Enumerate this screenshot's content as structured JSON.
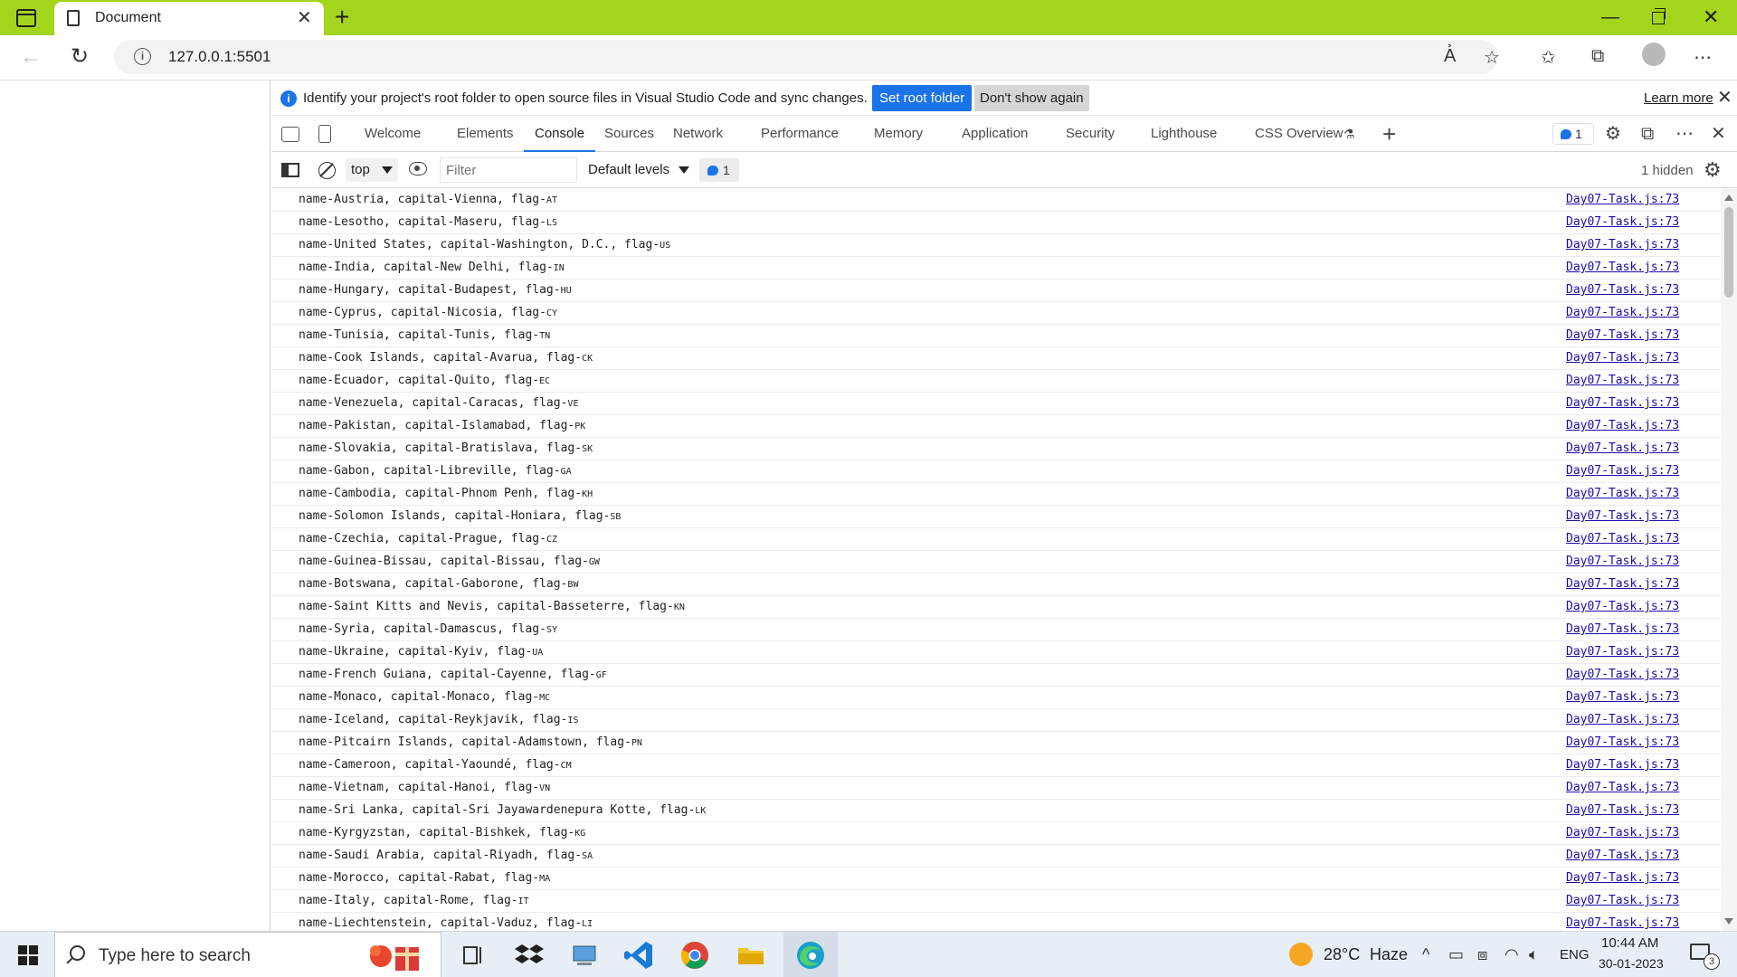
{
  "window": {
    "tab_title": "Document",
    "new_tab_glyph": "+",
    "close_glyph": "✕",
    "minimize_glyph": "—"
  },
  "address_bar": {
    "url": "127.0.0.1:5501",
    "icons": [
      "read-aloud-icon",
      "add-favorite-icon",
      "favorites-icon",
      "collections-icon",
      "profile-icon",
      "more-icon"
    ]
  },
  "infobar": {
    "message": "Identify your project's root folder to open source files in Visual Studio Code and sync changes.",
    "set_root_label": "Set root folder",
    "dont_show_label": "Don't show again",
    "learn_more_label": "Learn more"
  },
  "devtools": {
    "tabs": [
      {
        "label": "Welcome",
        "active": false
      },
      {
        "label": "Elements",
        "active": false
      },
      {
        "label": "Console",
        "active": true
      },
      {
        "label": "Sources",
        "active": false
      },
      {
        "label": "Network",
        "active": false
      },
      {
        "label": "Performance",
        "active": false
      },
      {
        "label": "Memory",
        "active": false
      },
      {
        "label": "Application",
        "active": false
      },
      {
        "label": "Security",
        "active": false
      },
      {
        "label": "Lighthouse",
        "active": false
      },
      {
        "label": "CSS Overview",
        "active": false
      }
    ],
    "issues_count": "1",
    "accent_color": "#1a73e8"
  },
  "console_bar": {
    "context": "top",
    "filter_placeholder": "Filter",
    "levels_label": "Default levels",
    "issues_count": "1",
    "hidden_label": "1 hidden"
  },
  "console": {
    "source": "Day07-Task.js:73",
    "rows": [
      {
        "msg": "name-Austria, capital-Vienna, flag-",
        "flag": "AT"
      },
      {
        "msg": "name-Lesotho, capital-Maseru, flag-",
        "flag": "LS"
      },
      {
        "msg": "name-United States, capital-Washington, D.C., flag-",
        "flag": "US"
      },
      {
        "msg": "name-India, capital-New Delhi, flag-",
        "flag": "IN"
      },
      {
        "msg": "name-Hungary, capital-Budapest, flag-",
        "flag": "HU"
      },
      {
        "msg": "name-Cyprus, capital-Nicosia, flag-",
        "flag": "CY"
      },
      {
        "msg": "name-Tunisia, capital-Tunis, flag-",
        "flag": "TN"
      },
      {
        "msg": "name-Cook Islands, capital-Avarua, flag-",
        "flag": "CK"
      },
      {
        "msg": "name-Ecuador, capital-Quito, flag-",
        "flag": "EC"
      },
      {
        "msg": "name-Venezuela, capital-Caracas, flag-",
        "flag": "VE"
      },
      {
        "msg": "name-Pakistan, capital-Islamabad, flag-",
        "flag": "PK"
      },
      {
        "msg": "name-Slovakia, capital-Bratislava, flag-",
        "flag": "SK"
      },
      {
        "msg": "name-Gabon, capital-Libreville, flag-",
        "flag": "GA"
      },
      {
        "msg": "name-Cambodia, capital-Phnom Penh, flag-",
        "flag": "KH"
      },
      {
        "msg": "name-Solomon Islands, capital-Honiara, flag-",
        "flag": "SB"
      },
      {
        "msg": "name-Czechia, capital-Prague, flag-",
        "flag": "CZ"
      },
      {
        "msg": "name-Guinea-Bissau, capital-Bissau, flag-",
        "flag": "GW"
      },
      {
        "msg": "name-Botswana, capital-Gaborone, flag-",
        "flag": "BW"
      },
      {
        "msg": "name-Saint Kitts and Nevis, capital-Basseterre, flag-",
        "flag": "KN"
      },
      {
        "msg": "name-Syria, capital-Damascus, flag-",
        "flag": "SY"
      },
      {
        "msg": "name-Ukraine, capital-Kyiv, flag-",
        "flag": "UA"
      },
      {
        "msg": "name-French Guiana, capital-Cayenne, flag-",
        "flag": "GF"
      },
      {
        "msg": "name-Monaco, capital-Monaco, flag-",
        "flag": "MC"
      },
      {
        "msg": "name-Iceland, capital-Reykjavik, flag-",
        "flag": "IS"
      },
      {
        "msg": "name-Pitcairn Islands, capital-Adamstown, flag-",
        "flag": "PN"
      },
      {
        "msg": "name-Cameroon, capital-Yaoundé, flag-",
        "flag": "CM"
      },
      {
        "msg": "name-Vietnam, capital-Hanoi, flag-",
        "flag": "VN"
      },
      {
        "msg": "name-Sri Lanka, capital-Sri Jayawardenepura Kotte, flag-",
        "flag": "LK"
      },
      {
        "msg": "name-Kyrgyzstan, capital-Bishkek, flag-",
        "flag": "KG"
      },
      {
        "msg": "name-Saudi Arabia, capital-Riyadh, flag-",
        "flag": "SA"
      },
      {
        "msg": "name-Morocco, capital-Rabat, flag-",
        "flag": "MA"
      },
      {
        "msg": "name-Italy, capital-Rome, flag-",
        "flag": "IT"
      },
      {
        "msg": "name-Liechtenstein, capital-Vaduz, flag-",
        "flag": "LI"
      }
    ]
  },
  "taskbar": {
    "search_placeholder": "Type here to search",
    "weather_temp": "28°C",
    "weather_desc": "Haze",
    "language": "ENG",
    "time": "10:44 AM",
    "date": "30-01-2023",
    "notifications": "3",
    "theme_color": "#a4d51c"
  }
}
